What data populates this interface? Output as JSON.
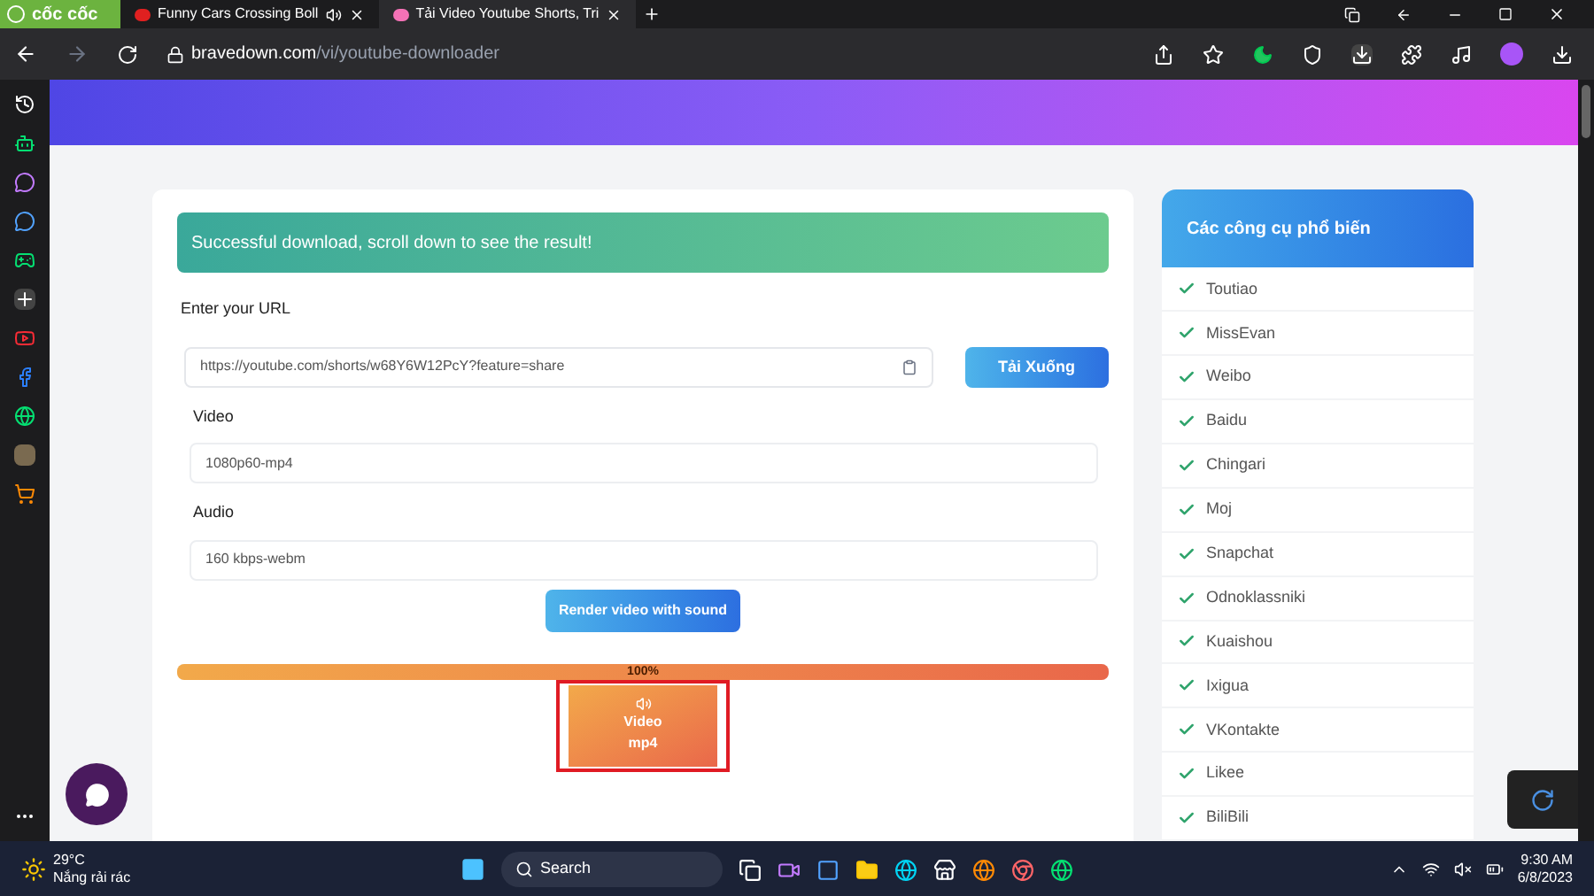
{
  "browser": {
    "brand": "cốc cốc",
    "tabs": [
      {
        "title": "Funny Cars Crossing Boll",
        "selected": false,
        "audio": true
      },
      {
        "title": "Tải Video Youtube Shorts, Tri",
        "selected": true,
        "audio": false
      }
    ],
    "address": {
      "host": "bravedown.com",
      "path": "/vi/youtube-downloader"
    }
  },
  "page": {
    "alert": "Successful download, scroll down to see the result!",
    "url_label": "Enter your URL",
    "url_value": "https://youtube.com/shorts/w68Y6W12PcY?feature=share",
    "download_button": "Tải Xuống",
    "video_label": "Video",
    "video_value": "1080p60-mp4",
    "audio_label": "Audio",
    "audio_value": "160 kbps-webm",
    "render_button": "Render video with sound",
    "progress": {
      "level": 1,
      "reading": "100%"
    },
    "result": {
      "title": "Video",
      "format": "mp4"
    }
  },
  "tools": {
    "title": "Các công cụ phổ biến",
    "items": [
      "Toutiao",
      "MissEvan",
      "Weibo",
      "Baidu",
      "Chingari",
      "Moj",
      "Snapchat",
      "Odnoklassniki",
      "Kuaishou",
      "Ixigua",
      "VKontakte",
      "Likee",
      "BiliBili"
    ]
  },
  "taskbar": {
    "temperature": "29°C",
    "weather": "Nắng rải rác",
    "search": "Search",
    "time": "9:30 AM",
    "date": "6/8/2023"
  }
}
